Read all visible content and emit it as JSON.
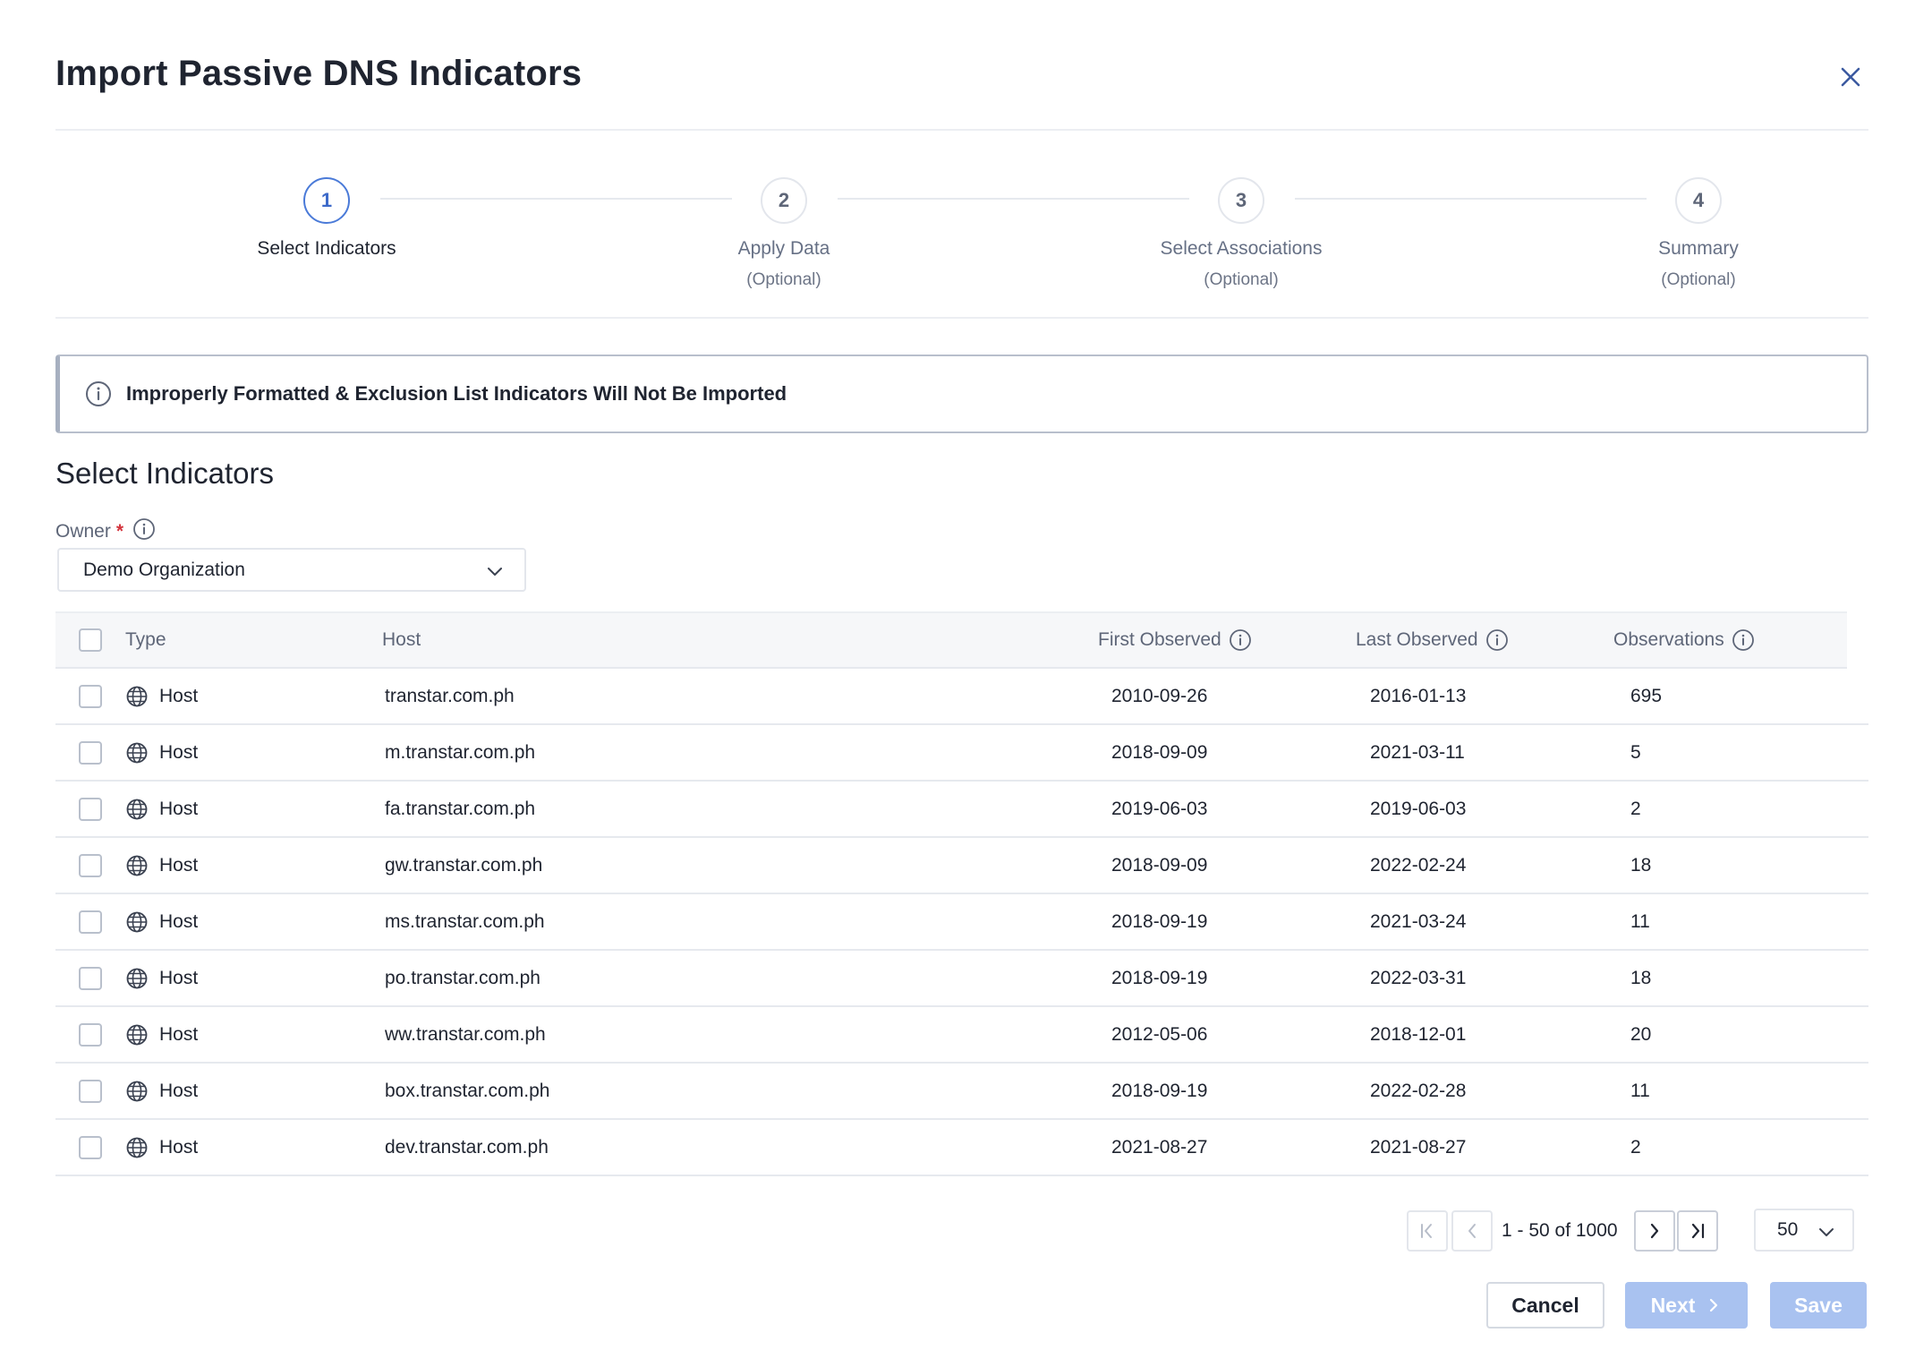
{
  "dialog": {
    "title": "Import Passive DNS Indicators",
    "close_icon": "close-icon"
  },
  "stepper": {
    "steps": [
      {
        "number": "1",
        "label": "Select Indicators",
        "sub": "",
        "active": true
      },
      {
        "number": "2",
        "label": "Apply Data",
        "sub": "(Optional)",
        "active": false
      },
      {
        "number": "3",
        "label": "Select Associations",
        "sub": "(Optional)",
        "active": false
      },
      {
        "number": "4",
        "label": "Summary",
        "sub": "(Optional)",
        "active": false
      }
    ]
  },
  "alert": {
    "icon": "info-icon",
    "text": "Improperly Formatted & Exclusion List Indicators Will Not Be Imported"
  },
  "section": {
    "title": "Select Indicators"
  },
  "owner": {
    "label": "Owner",
    "required_mark": "*",
    "value": "Demo Organization"
  },
  "table": {
    "columns": {
      "type": "Type",
      "host": "Host",
      "first_observed": "First Observed",
      "last_observed": "Last Observed",
      "observations": "Observations"
    },
    "rows": [
      {
        "type": "Host",
        "host": "transtar.com.ph",
        "first": "2010-09-26",
        "last": "2016-01-13",
        "obs": "695"
      },
      {
        "type": "Host",
        "host": "m.transtar.com.ph",
        "first": "2018-09-09",
        "last": "2021-03-11",
        "obs": "5"
      },
      {
        "type": "Host",
        "host": "fa.transtar.com.ph",
        "first": "2019-06-03",
        "last": "2019-06-03",
        "obs": "2"
      },
      {
        "type": "Host",
        "host": "gw.transtar.com.ph",
        "first": "2018-09-09",
        "last": "2022-02-24",
        "obs": "18"
      },
      {
        "type": "Host",
        "host": "ms.transtar.com.ph",
        "first": "2018-09-19",
        "last": "2021-03-24",
        "obs": "11"
      },
      {
        "type": "Host",
        "host": "po.transtar.com.ph",
        "first": "2018-09-19",
        "last": "2022-03-31",
        "obs": "18"
      },
      {
        "type": "Host",
        "host": "ww.transtar.com.ph",
        "first": "2012-05-06",
        "last": "2018-12-01",
        "obs": "20"
      },
      {
        "type": "Host",
        "host": "box.transtar.com.ph",
        "first": "2018-09-19",
        "last": "2022-02-28",
        "obs": "11"
      },
      {
        "type": "Host",
        "host": "dev.transtar.com.ph",
        "first": "2021-08-27",
        "last": "2021-08-27",
        "obs": "2"
      }
    ]
  },
  "pagination": {
    "range_text": "1 - 50 of 1000",
    "page_size": "50"
  },
  "footer": {
    "cancel_label": "Cancel",
    "next_label": "Next",
    "save_label": "Save"
  },
  "colors": {
    "accent": "#3c69c9",
    "disabled_button": "#a9c2f0",
    "required": "#d3333c"
  }
}
